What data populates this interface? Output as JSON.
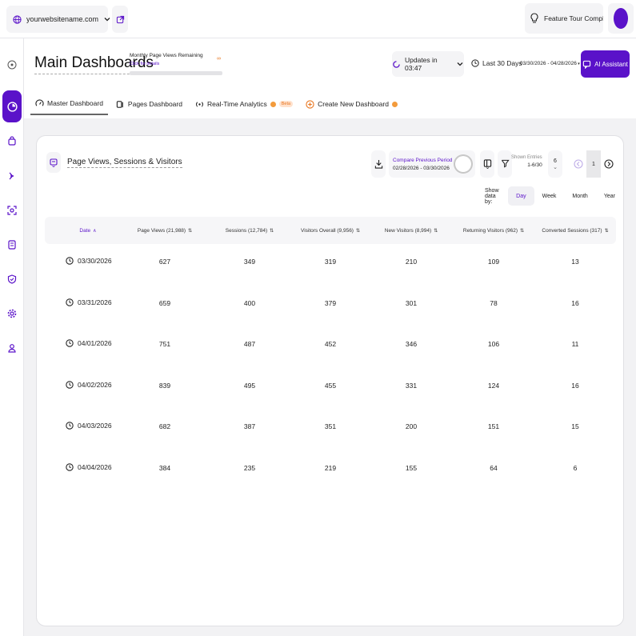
{
  "topbar": {
    "site": "yourwebsitename.com",
    "tour_label": "Feature Tour Complet..."
  },
  "header": {
    "title": "Main Dashboards",
    "quota_label": "Monthly Page Views Remaining",
    "quota_link": "Click for details",
    "quota_value": "∞",
    "update_label": "Updates in 03:47",
    "range_label": "Last 30 Days",
    "range_dates": "03/30/2026 - 04/28/2026",
    "ai_label": "AI Assistant",
    "tabs": [
      {
        "label": "Master Dashboard"
      },
      {
        "label": "Pages Dashboard"
      },
      {
        "label": "Real-Time Analytics",
        "badge": "Beta"
      },
      {
        "label": "Create New Dashboard"
      }
    ]
  },
  "card": {
    "title": "Page Views, Sessions & Visitors",
    "compare_label": "Compare Previous Period",
    "compare_range": "02/28/2026 - 03/30/2026",
    "entries_label": "Shown Entries",
    "entries_range": "1-6/30",
    "entries_count": "6",
    "page_number": "1",
    "show_by_label": "Show data by:",
    "periods": [
      "Day",
      "Week",
      "Month",
      "Year"
    ],
    "active_period": "Day",
    "columns": [
      "Date",
      "Page Views (21,988)",
      "Sessions (12,784)",
      "Visitors Overall (9,956)",
      "New Visitors (8,994)",
      "Returning Visitors (962)",
      "Converted Sessions (317)"
    ],
    "rows": [
      [
        "03/30/2026",
        "627",
        "349",
        "319",
        "210",
        "109",
        "13"
      ],
      [
        "03/31/2026",
        "659",
        "400",
        "379",
        "301",
        "78",
        "16"
      ],
      [
        "04/01/2026",
        "751",
        "487",
        "452",
        "346",
        "106",
        "11"
      ],
      [
        "04/02/2026",
        "839",
        "495",
        "455",
        "331",
        "124",
        "16"
      ],
      [
        "04/03/2026",
        "682",
        "387",
        "351",
        "200",
        "151",
        "15"
      ],
      [
        "04/04/2026",
        "384",
        "235",
        "219",
        "155",
        "64",
        "6"
      ]
    ]
  },
  "colors": {
    "accent": "#5a12c9",
    "orange": "#e8761f"
  }
}
